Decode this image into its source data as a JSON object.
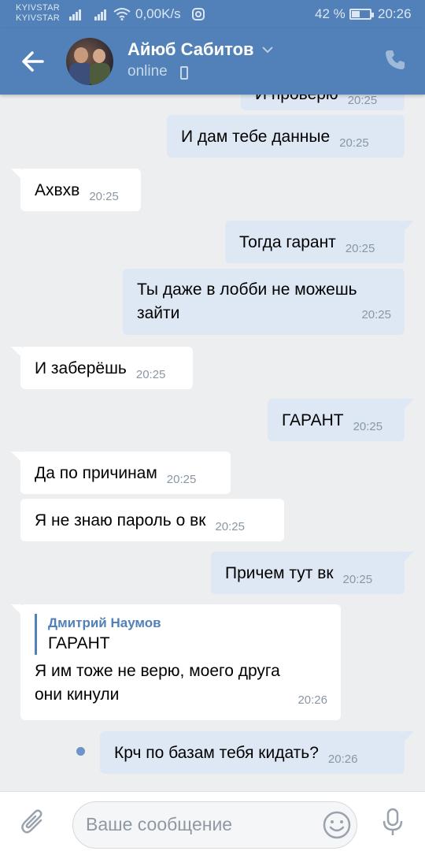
{
  "status_bar": {
    "carrier1": "KYIVSTAR",
    "carrier2": "KYIVSTAR",
    "speed": "0,00K/s",
    "battery": "42 %",
    "battery_level": 0.42,
    "time": "20:26",
    "icons": [
      "signal-icon",
      "signal-icon",
      "wifi-icon",
      "instagram-icon",
      "battery-icon"
    ]
  },
  "header": {
    "back_icon": "arrow-left-icon",
    "name": "Айюб Сабитов",
    "presence": "online",
    "presence_icon": "mobile-phone-icon",
    "call_icon": "phone-call-icon"
  },
  "messages": [
    {
      "dir": "out",
      "text": "И проверю",
      "time": "20:25"
    },
    {
      "dir": "out",
      "text": "И дам тебе данные",
      "time": "20:25"
    },
    {
      "dir": "in",
      "text": "Ахвхв",
      "time": "20:25"
    },
    {
      "dir": "out",
      "text": "Тогда гарант",
      "time": "20:25"
    },
    {
      "dir": "out",
      "text_line1": "Ты даже в лобби не можешь",
      "text_line2": "зайти",
      "time": "20:25"
    },
    {
      "dir": "in",
      "text": "И заберёшь",
      "time": "20:25"
    },
    {
      "dir": "out",
      "text": "ГАРАНТ",
      "time": "20:25"
    },
    {
      "dir": "in",
      "text": "Да по причинам",
      "time": "20:25"
    },
    {
      "dir": "in",
      "text": "Я не знаю пароль о вк",
      "time": "20:25"
    },
    {
      "dir": "out",
      "text": "Причем тут вк",
      "time": "20:25"
    },
    {
      "dir": "in",
      "reply_name": "Дмитрий Наумов",
      "reply_text": "ГАРАНТ",
      "text_line1": "Я им тоже не верю, моего друга",
      "text_line2": "они кинули",
      "time": "20:26"
    },
    {
      "dir": "out",
      "text": "Крч по базам тебя кидать?",
      "time": "20:26",
      "unread": true
    }
  ],
  "composer": {
    "attach_icon": "paperclip-icon",
    "placeholder": "Ваше сообщение",
    "emoji_icon": "smile-icon",
    "mic_icon": "microphone-icon"
  },
  "colors": {
    "brand": "#5181b8",
    "bubble_out": "#dee8f5",
    "bubble_in": "#ffffff",
    "background": "#edeef0"
  }
}
